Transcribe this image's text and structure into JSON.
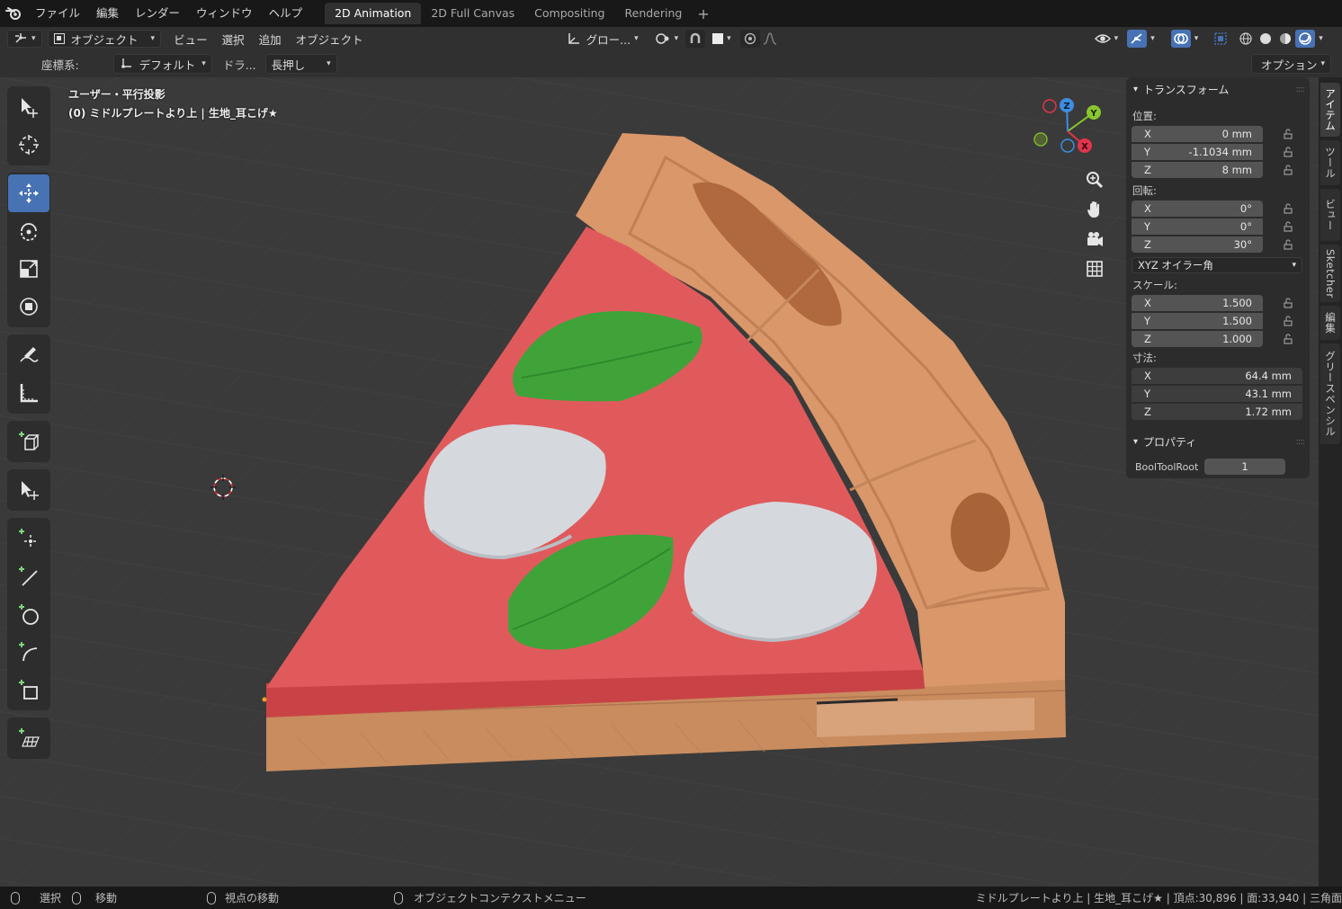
{
  "topbar": {
    "menus": [
      "ファイル",
      "編集",
      "レンダー",
      "ウィンドウ",
      "ヘルプ"
    ],
    "workspaces": [
      "2D Animation",
      "2D Full Canvas",
      "Compositing",
      "Rendering"
    ],
    "active_workspace": "2D Animation",
    "add_label": "+"
  },
  "vpheader": {
    "mode": "オブジェクト",
    "menus": [
      "ビュー",
      "選択",
      "追加",
      "オブジェクト"
    ],
    "orientation": "グロー..."
  },
  "toolsettings": {
    "coord_label": "座標系:",
    "coord_value": "デフォルト",
    "drag_label": "ドラ...",
    "drag_value": "長押し",
    "options": "オプション"
  },
  "viewport": {
    "view_name": "ユーザー・平行投影",
    "object_info": "(0) ミドルプレートより上 | 生地_耳こげ★"
  },
  "gizmo": {
    "x": "X",
    "y": "Y",
    "z": "Z",
    "colors": {
      "x": "#e2344b",
      "y": "#8ac72e",
      "z": "#3d8de0"
    }
  },
  "npanel": {
    "transform_title": "トランスフォーム",
    "location_label": "位置:",
    "location": [
      {
        "axis": "X",
        "value": "0 mm"
      },
      {
        "axis": "Y",
        "value": "-1.1034 mm"
      },
      {
        "axis": "Z",
        "value": "8 mm"
      }
    ],
    "rotation_label": "回転:",
    "rotation": [
      {
        "axis": "X",
        "value": "0°"
      },
      {
        "axis": "Y",
        "value": "0°"
      },
      {
        "axis": "Z",
        "value": "30°"
      }
    ],
    "rotation_mode": "XYZ オイラー角",
    "scale_label": "スケール:",
    "scale": [
      {
        "axis": "X",
        "value": "1.500"
      },
      {
        "axis": "Y",
        "value": "1.500"
      },
      {
        "axis": "Z",
        "value": "1.000"
      }
    ],
    "dimensions_label": "寸法:",
    "dimensions": [
      {
        "axis": "X",
        "value": "64.4 mm"
      },
      {
        "axis": "Y",
        "value": "43.1 mm"
      },
      {
        "axis": "Z",
        "value": "1.72 mm"
      }
    ],
    "properties_title": "プロパティ",
    "prop_name": "BoolToolRoot",
    "prop_value": "1"
  },
  "sidetabs": [
    "アイテム",
    "ツール",
    "ビュー",
    "Sketcher",
    "編集",
    "グリースペンシル"
  ],
  "statusbar": {
    "select": "選択",
    "move": "移動",
    "view_move": "視点の移動",
    "context_menu": "オブジェクトコンテクストメニュー",
    "stats": "ミドルプレートより上 | 生地_耳こげ★ | 頂点:30,896 | 面:33,940 | 三角面"
  },
  "colors": {
    "accent": "#4772b3",
    "sauce": "#e05a5c",
    "crust": "#d9976a",
    "basil": "#3fa33a",
    "cheese": "#d5d9de"
  }
}
